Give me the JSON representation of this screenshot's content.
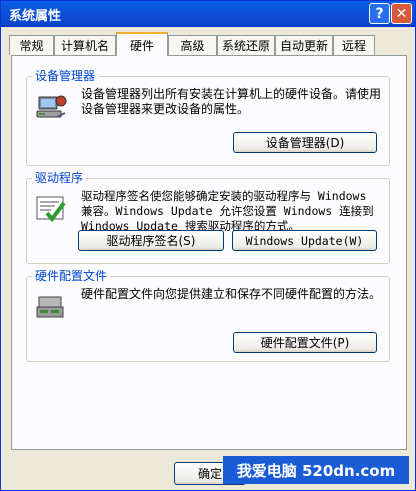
{
  "window": {
    "title": "系统属性"
  },
  "titlebar": {
    "help_label": "?",
    "close_label": "✕"
  },
  "tabs": [
    {
      "label": "常规"
    },
    {
      "label": "计算机名"
    },
    {
      "label": "硬件"
    },
    {
      "label": "高级"
    },
    {
      "label": "系统还原"
    },
    {
      "label": "自动更新"
    },
    {
      "label": "远程"
    }
  ],
  "active_tab": "硬件",
  "device_manager": {
    "title": "设备管理器",
    "description": "设备管理器列出所有安装在计算机上的硬件设备。请使用设备管理器来更改设备的属性。",
    "button": "设备管理器(D)",
    "icon": "device-manager-icon"
  },
  "drivers": {
    "title": "驱动程序",
    "description": "驱动程序签名使您能够确定安装的驱动程序与 Windows 兼容。Windows Update 允许您设置 Windows 连接到 Windows Update 搜索驱动程序的方式。",
    "button_signing": "驱动程序签名(S)",
    "button_update": "Windows Update(W)",
    "icon": "driver-signing-icon"
  },
  "hardware_profiles": {
    "title": "硬件配置文件",
    "description": "硬件配置文件向您提供建立和保存不同硬件配置的方法。",
    "button": "硬件配置文件(P)",
    "icon": "hardware-profile-icon"
  },
  "footer": {
    "ok_label": "确定"
  },
  "watermark": {
    "text": "我爱电脑 520dn.com"
  },
  "colors": {
    "titlebar": "#0a5fe8",
    "group_title": "#0046d5",
    "window_bg": "#ece9d8"
  }
}
